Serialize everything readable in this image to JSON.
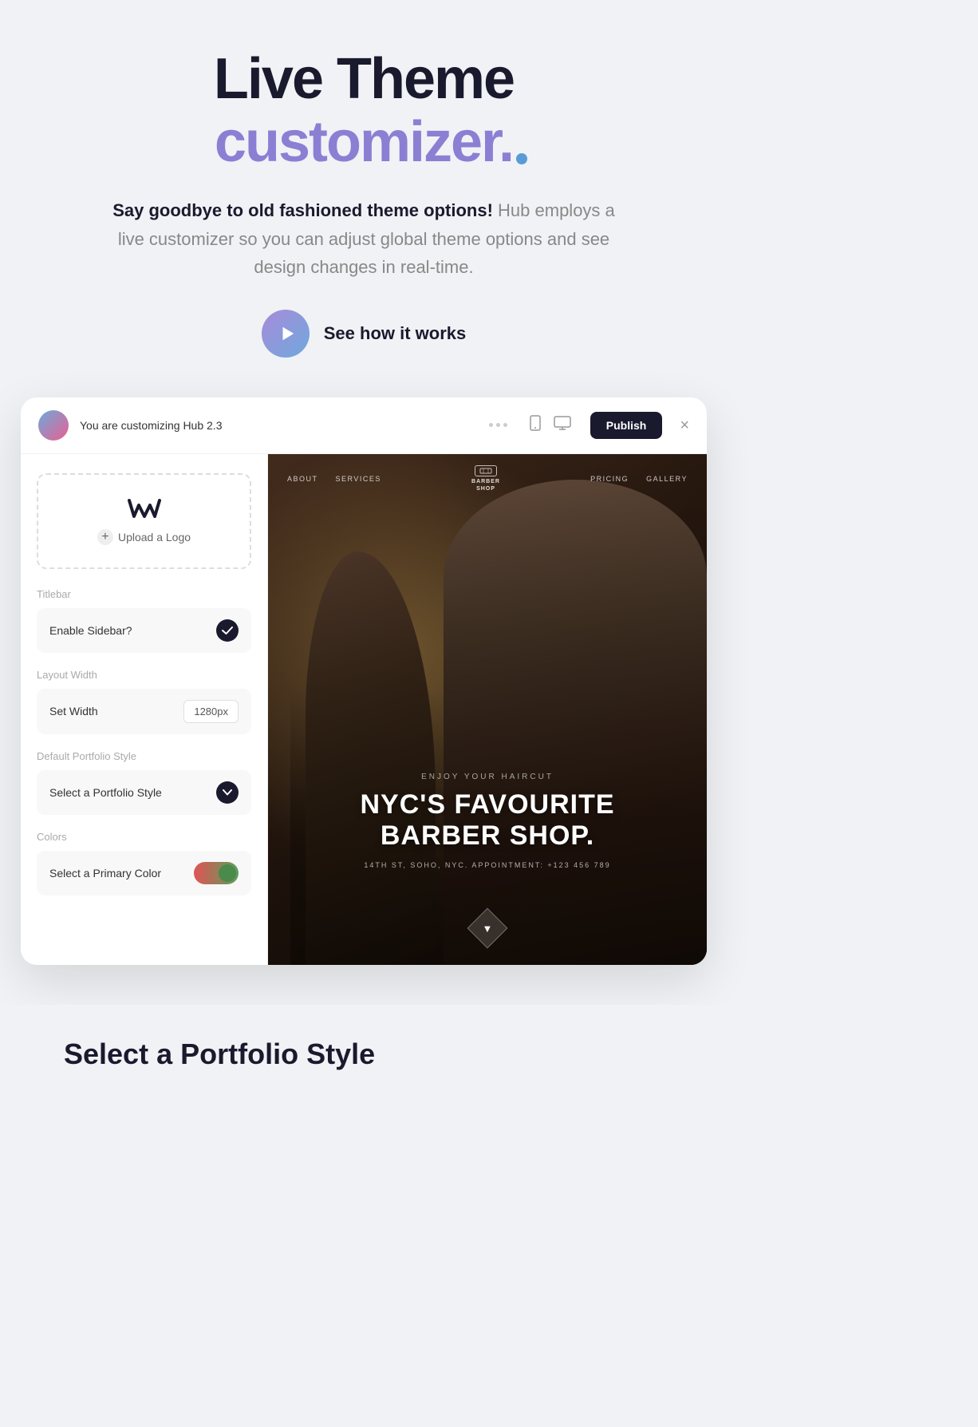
{
  "hero": {
    "title_line1": "Live Theme",
    "title_line2": "customizer.",
    "description_bold": "Say goodbye to old fashioned theme options!",
    "description_brand": " Hub",
    "description_rest": " employs a live customizer so you can adjust global theme options and see design changes in real-time.",
    "play_label": "See how it works"
  },
  "widget": {
    "header": {
      "customizing_text": "You are customizing Hub 2.3",
      "publish_label": "Publish",
      "close_label": "×"
    },
    "left_panel": {
      "logo_upload_label": "Upload a Logo",
      "titlebar_label": "Titlebar",
      "enable_sidebar_label": "Enable Sidebar?",
      "layout_width_label": "Layout Width",
      "set_width_label": "Set Width",
      "width_value": "1280px",
      "portfolio_style_label": "Default Portfolio Style",
      "select_portfolio_label": "Select a Portfolio Style",
      "colors_label": "Colors",
      "select_color_label": "Select a Primary Color"
    },
    "right_panel": {
      "nav": {
        "about": "ABOUT",
        "services": "SERVICES",
        "logo_text": "BARBER\nSHOP",
        "pricing": "PRICING",
        "gallery": "GALLERY"
      },
      "content": {
        "enjoy_text": "ENJOY YOUR HAIRCUT",
        "headline_line1": "NYC'S FAVOURITE",
        "headline_line2": "BARBER SHOP.",
        "address": "14TH ST, SOHO, NYC. APPOINTMENT: +123 456 789"
      }
    }
  },
  "bottom": {
    "select_portfolio_label": "Select a Portfolio Style"
  }
}
